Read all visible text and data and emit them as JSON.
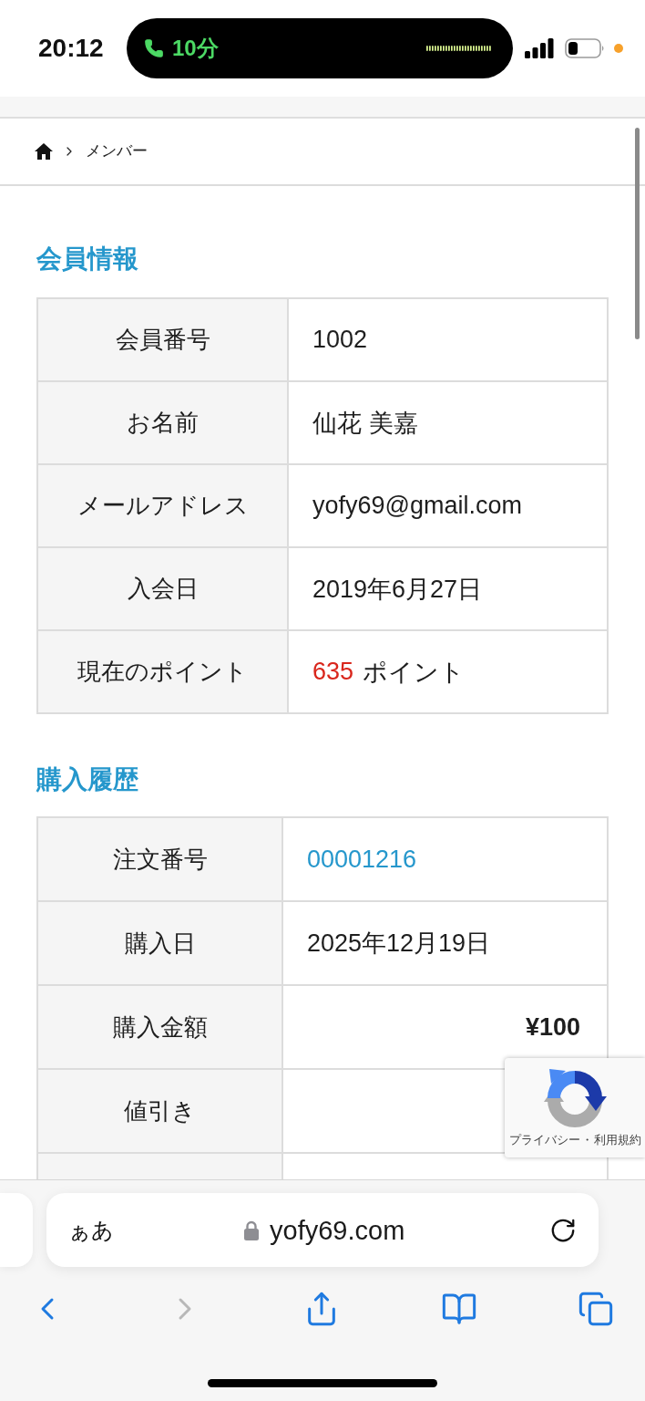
{
  "status_bar": {
    "time": "20:12",
    "call": {
      "duration": "10分"
    }
  },
  "breadcrumb": {
    "items": [
      {
        "label": "メンバー"
      }
    ]
  },
  "sections": [
    {
      "title": "会員情報",
      "rows": [
        {
          "label": "会員番号",
          "kind": "text",
          "value": "1002"
        },
        {
          "label": "お名前",
          "kind": "text",
          "value": "仙花 美嘉"
        },
        {
          "label": "メールアドレス",
          "kind": "text",
          "value": "yofy69@gmail.com"
        },
        {
          "label": "入会日",
          "kind": "text",
          "value": "2019年6月27日"
        },
        {
          "label": "現在のポイント",
          "kind": "points",
          "value": "635",
          "unit": "ポイント"
        }
      ]
    },
    {
      "title": "購入履歴",
      "rows": [
        {
          "label": "注文番号",
          "kind": "link",
          "value": "00001216"
        },
        {
          "label": "購入日",
          "kind": "text",
          "value": "2025年12月19日"
        },
        {
          "label": "購入金額",
          "kind": "amount",
          "value": "¥100"
        },
        {
          "label": "値引き",
          "kind": "text"
        },
        {
          "kind": "text"
        }
      ]
    }
  ],
  "recaptcha": {
    "privacy": "プライバシー",
    "separator": "・",
    "terms": "利用規約"
  },
  "browser": {
    "address_bar": {
      "text_size": "ぁあ",
      "url": "yofy69.com"
    },
    "toolbar": [
      {
        "kind": "back",
        "disabled": false
      },
      {
        "kind": "forward",
        "disabled": true
      },
      {
        "kind": "share",
        "disabled": false
      },
      {
        "kind": "bookmarks",
        "disabled": false
      },
      {
        "kind": "tabs",
        "disabled": false
      }
    ]
  }
}
